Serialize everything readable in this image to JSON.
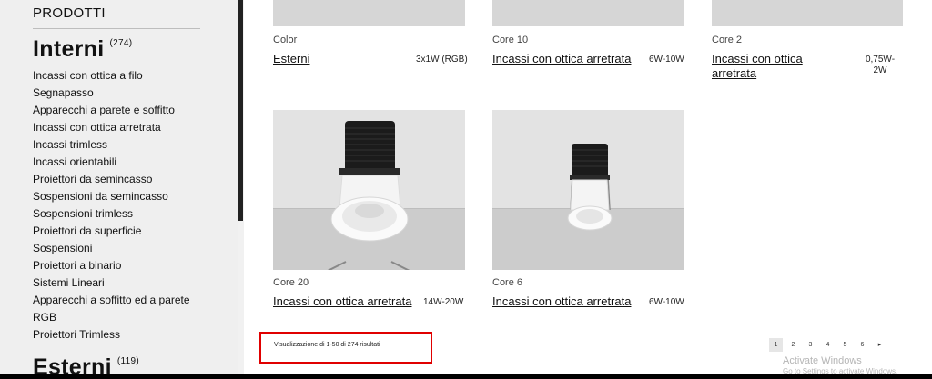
{
  "sidebar": {
    "title": "PRODOTTI",
    "categories": [
      {
        "name": "Interni",
        "count": "(274)"
      },
      {
        "name": "Esterni",
        "count": "(119)"
      }
    ],
    "items": [
      "Incassi con ottica a filo",
      "Segnapasso",
      "Apparecchi a parete e soffitto",
      "Incassi con ottica arretrata",
      "Incassi trimless",
      "Incassi orientabili",
      "Proiettori da semincasso",
      "Sospensioni da semincasso",
      "Sospensioni trimless",
      "Proiettori da superficie",
      "Sospensioni",
      "Proiettori a binario",
      "Sistemi Lineari",
      "Apparecchi a soffitto ed a parete",
      "RGB",
      "Proiettori Trimless"
    ]
  },
  "products": [
    {
      "subtitle": "Color",
      "name": "Esterni",
      "spec": "3x1W (RGB)"
    },
    {
      "subtitle": "Core 10",
      "name": "Incassi con ottica arretrata",
      "spec": "6W-10W"
    },
    {
      "subtitle": "Core 2",
      "name": "Incassi con ottica arretrata",
      "spec": "0,75W-\n2W"
    },
    {
      "subtitle": "Core 20",
      "name": "Incassi con ottica arretrata",
      "spec": "14W-20W"
    },
    {
      "subtitle": "Core 6",
      "name": "Incassi con ottica arretrata",
      "spec": "6W-10W"
    }
  ],
  "results_text": "Visualizzazione di 1-50 di 274 risultati",
  "pagination": {
    "pages": [
      "1",
      "2",
      "3",
      "4",
      "5",
      "6"
    ],
    "next": "▸",
    "current": "1"
  },
  "watermark": {
    "line1": "Activate Windows",
    "line2": "Go to Settings to activate Windows."
  },
  "colors": {
    "highlight_border": "#e00000",
    "sidebar_bg": "#efefef"
  }
}
